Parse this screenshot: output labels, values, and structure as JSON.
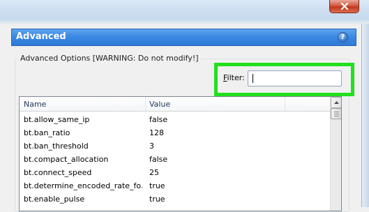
{
  "window": {
    "close_icon": "close-icon"
  },
  "header": {
    "title": "Advanced",
    "help_icon": "help-icon",
    "help_glyph": "?"
  },
  "options_group": {
    "label": "Advanced Options [WARNING: Do not modify!]"
  },
  "filter": {
    "label_accel": "F",
    "label_rest": "ilter:",
    "value": ""
  },
  "list": {
    "columns": [
      "Name",
      "Value"
    ],
    "rows": [
      {
        "name": "bt.allow_same_ip",
        "value": "false"
      },
      {
        "name": "bt.ban_ratio",
        "value": "128"
      },
      {
        "name": "bt.ban_threshold",
        "value": "3"
      },
      {
        "name": "bt.compact_allocation",
        "value": "false"
      },
      {
        "name": "bt.connect_speed",
        "value": "25"
      },
      {
        "name": "bt.determine_encoded_rate_fo...",
        "value": "true"
      },
      {
        "name": "bt.enable_pulse",
        "value": "true"
      }
    ]
  },
  "colors": {
    "header_blue": "#3a87e2",
    "highlight_green": "#22e01c",
    "close_red": "#c2371f"
  }
}
